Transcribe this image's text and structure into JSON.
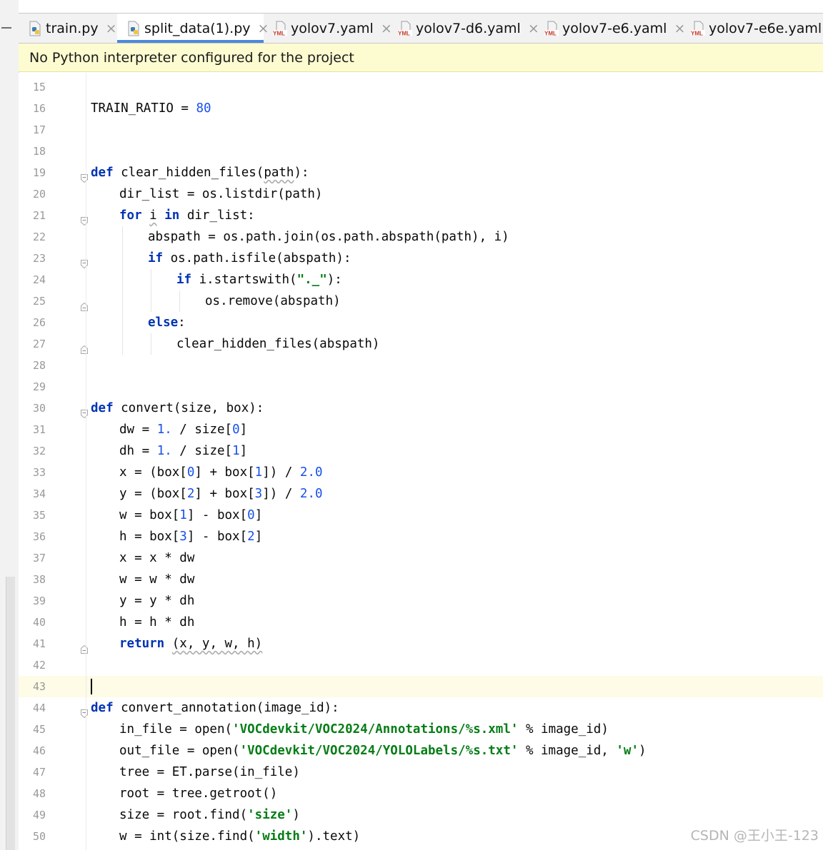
{
  "tabs": [
    {
      "label": "train.py",
      "icon": "python-file-icon",
      "active": false
    },
    {
      "label": "split_data(1).py",
      "icon": "python-file-icon",
      "active": true
    },
    {
      "label": "yolov7.yaml",
      "icon": "yaml-file-icon",
      "active": false
    },
    {
      "label": "yolov7-d6.yaml",
      "icon": "yaml-file-icon",
      "active": false
    },
    {
      "label": "yolov7-e6.yaml",
      "icon": "yaml-file-icon",
      "active": false
    },
    {
      "label": "yolov7-e6e.yaml",
      "icon": "yaml-file-icon",
      "active": false
    }
  ],
  "tab_close_glyph": "×",
  "banner": {
    "text": "No Python interpreter configured for the project"
  },
  "editor": {
    "current_line": 43,
    "lines": [
      {
        "n": "15",
        "indent": 0,
        "tokens": []
      },
      {
        "n": "16",
        "indent": 0,
        "tokens": [
          {
            "t": "TRAIN_RATIO = "
          },
          {
            "t": "80",
            "c": "num"
          }
        ]
      },
      {
        "n": "17",
        "indent": 0,
        "tokens": []
      },
      {
        "n": "18",
        "indent": 0,
        "tokens": []
      },
      {
        "n": "19",
        "indent": 0,
        "fold": "open",
        "tokens": [
          {
            "t": "def",
            "c": "kw"
          },
          {
            "t": " clear_hidden_files("
          },
          {
            "t": "path",
            "c": "wavy"
          },
          {
            "t": "):"
          }
        ]
      },
      {
        "n": "20",
        "indent": 1,
        "tokens": [
          {
            "t": "dir_list = os.listdir(path)"
          }
        ]
      },
      {
        "n": "21",
        "indent": 1,
        "fold": "open",
        "tokens": [
          {
            "t": "for",
            "c": "kw"
          },
          {
            "t": " "
          },
          {
            "t": "i",
            "c": "wavy"
          },
          {
            "t": " "
          },
          {
            "t": "in",
            "c": "kw"
          },
          {
            "t": " dir_list:"
          }
        ]
      },
      {
        "n": "22",
        "indent": 2,
        "tokens": [
          {
            "t": "abspath = os.path.join(os.path.abspath(path), i)"
          }
        ]
      },
      {
        "n": "23",
        "indent": 2,
        "fold": "open",
        "tokens": [
          {
            "t": "if",
            "c": "kw"
          },
          {
            "t": " os.path.isfile(abspath):"
          }
        ]
      },
      {
        "n": "24",
        "indent": 3,
        "tokens": [
          {
            "t": "if",
            "c": "kw"
          },
          {
            "t": " i.startswith("
          },
          {
            "t": "\"._\"",
            "c": "str"
          },
          {
            "t": "):"
          }
        ]
      },
      {
        "n": "25",
        "indent": 4,
        "fold": "end",
        "tokens": [
          {
            "t": "os.remove(abspath)"
          }
        ]
      },
      {
        "n": "26",
        "indent": 2,
        "tokens": [
          {
            "t": "else",
            "c": "kw"
          },
          {
            "t": ":"
          }
        ]
      },
      {
        "n": "27",
        "indent": 3,
        "fold": "end",
        "tokens": [
          {
            "t": "clear_hidden_files(abspath)"
          }
        ]
      },
      {
        "n": "28",
        "indent": 0,
        "tokens": []
      },
      {
        "n": "29",
        "indent": 0,
        "tokens": []
      },
      {
        "n": "30",
        "indent": 0,
        "fold": "open",
        "tokens": [
          {
            "t": "def",
            "c": "kw"
          },
          {
            "t": " convert(size, box):"
          }
        ]
      },
      {
        "n": "31",
        "indent": 1,
        "tokens": [
          {
            "t": "dw = "
          },
          {
            "t": "1.",
            "c": "num"
          },
          {
            "t": " / size["
          },
          {
            "t": "0",
            "c": "num"
          },
          {
            "t": "]"
          }
        ]
      },
      {
        "n": "32",
        "indent": 1,
        "tokens": [
          {
            "t": "dh = "
          },
          {
            "t": "1.",
            "c": "num"
          },
          {
            "t": " / size["
          },
          {
            "t": "1",
            "c": "num"
          },
          {
            "t": "]"
          }
        ]
      },
      {
        "n": "33",
        "indent": 1,
        "tokens": [
          {
            "t": "x = (box["
          },
          {
            "t": "0",
            "c": "num"
          },
          {
            "t": "] + box["
          },
          {
            "t": "1",
            "c": "num"
          },
          {
            "t": "]) / "
          },
          {
            "t": "2.0",
            "c": "num"
          }
        ]
      },
      {
        "n": "34",
        "indent": 1,
        "tokens": [
          {
            "t": "y = (box["
          },
          {
            "t": "2",
            "c": "num"
          },
          {
            "t": "] + box["
          },
          {
            "t": "3",
            "c": "num"
          },
          {
            "t": "]) / "
          },
          {
            "t": "2.0",
            "c": "num"
          }
        ]
      },
      {
        "n": "35",
        "indent": 1,
        "tokens": [
          {
            "t": "w = box["
          },
          {
            "t": "1",
            "c": "num"
          },
          {
            "t": "] - box["
          },
          {
            "t": "0",
            "c": "num"
          },
          {
            "t": "]"
          }
        ]
      },
      {
        "n": "36",
        "indent": 1,
        "tokens": [
          {
            "t": "h = box["
          },
          {
            "t": "3",
            "c": "num"
          },
          {
            "t": "] - box["
          },
          {
            "t": "2",
            "c": "num"
          },
          {
            "t": "]"
          }
        ]
      },
      {
        "n": "37",
        "indent": 1,
        "tokens": [
          {
            "t": "x = x * dw"
          }
        ]
      },
      {
        "n": "38",
        "indent": 1,
        "tokens": [
          {
            "t": "w = w * dw"
          }
        ]
      },
      {
        "n": "39",
        "indent": 1,
        "tokens": [
          {
            "t": "y = y * dh"
          }
        ]
      },
      {
        "n": "40",
        "indent": 1,
        "tokens": [
          {
            "t": "h = h * dh"
          }
        ]
      },
      {
        "n": "41",
        "indent": 1,
        "fold": "end",
        "tokens": [
          {
            "t": "return",
            "c": "kw"
          },
          {
            "t": " "
          },
          {
            "t": "(x, y, w, h)",
            "c": "wavy"
          }
        ]
      },
      {
        "n": "42",
        "indent": 0,
        "tokens": []
      },
      {
        "n": "43",
        "indent": 0,
        "tokens": []
      },
      {
        "n": "44",
        "indent": 0,
        "fold": "open",
        "tokens": [
          {
            "t": "def",
            "c": "kw"
          },
          {
            "t": " convert_annotation(image_id):"
          }
        ]
      },
      {
        "n": "45",
        "indent": 1,
        "tokens": [
          {
            "t": "in_file = open("
          },
          {
            "t": "'VOCdevkit/VOC2024/Annotations/%s.xml'",
            "c": "str"
          },
          {
            "t": " % image_id)"
          }
        ]
      },
      {
        "n": "46",
        "indent": 1,
        "tokens": [
          {
            "t": "out_file = open("
          },
          {
            "t": "'VOCdevkit/VOC2024/YOLOLabels/%s.txt'",
            "c": "str"
          },
          {
            "t": " % image_id, "
          },
          {
            "t": "'w'",
            "c": "str"
          },
          {
            "t": ")"
          }
        ]
      },
      {
        "n": "47",
        "indent": 1,
        "tokens": [
          {
            "t": "tree = ET.parse(in_file)"
          }
        ]
      },
      {
        "n": "48",
        "indent": 1,
        "tokens": [
          {
            "t": "root = tree.getroot()"
          }
        ]
      },
      {
        "n": "49",
        "indent": 1,
        "tokens": [
          {
            "t": "size = root.find("
          },
          {
            "t": "'size'",
            "c": "str"
          },
          {
            "t": ")"
          }
        ]
      },
      {
        "n": "50",
        "indent": 1,
        "tokens": [
          {
            "t": "w = int(size.find("
          },
          {
            "t": "'width'",
            "c": "str"
          },
          {
            "t": ").text)"
          }
        ]
      }
    ]
  },
  "watermark": "CSDN @王小王-123",
  "colors": {
    "keyword": "#0033b3",
    "number": "#1750eb",
    "string": "#067d17",
    "banner_bg": "#fdfbd0",
    "current_line_bg": "#fefbe6",
    "active_tab_underline": "#4a89dc"
  }
}
